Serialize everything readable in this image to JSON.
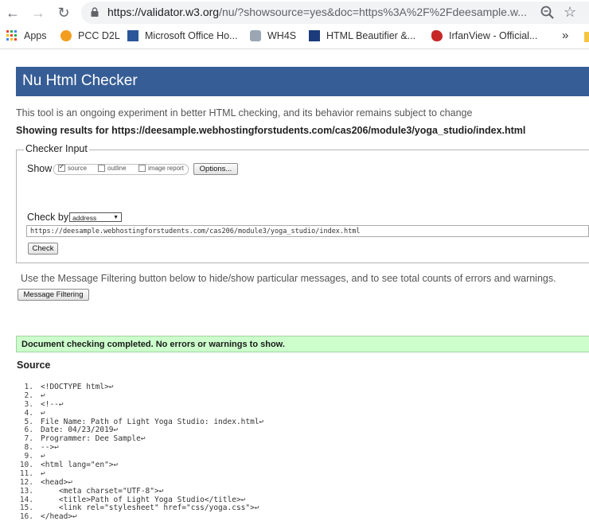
{
  "browser": {
    "url_host": "https://validator.w3.org",
    "url_rest": "/nu/?showsource=yes&doc=https%3A%2F%2Fdeesample.w...",
    "bookmarks": [
      {
        "label": "Apps"
      },
      {
        "label": "PCC D2L"
      },
      {
        "label": "Microsoft Office Ho..."
      },
      {
        "label": "WH4S"
      },
      {
        "label": "HTML Beautifier &..."
      },
      {
        "label": "IrfanView - Official..."
      }
    ],
    "more_glyph": "»"
  },
  "page": {
    "title": "Nu Html Checker",
    "intro": "This tool is an ongoing experiment in better HTML checking, and its behavior remains subject to change",
    "showing": "Showing results for https://deesample.webhostingforstudents.com/cas206/module3/yoga_studio/index.html",
    "checker": {
      "legend": "Checker Input",
      "show_label": "Show",
      "options": [
        {
          "label": "source",
          "checked": true
        },
        {
          "label": "outline",
          "checked": false
        },
        {
          "label": "image report",
          "checked": false
        }
      ],
      "options_button": "Options...",
      "check_by_label": "Check by",
      "check_by_value": "address",
      "address_value": "https://deesample.webhostingforstudents.com/cas206/module3/yoga_studio/index.html",
      "check_button": "Check"
    },
    "filter_info": "Use the Message Filtering button below to hide/show particular messages, and to see total counts of errors and warnings.",
    "filter_button": "Message Filtering",
    "success": "Document checking completed. No errors or warnings to show.",
    "source_heading": "Source",
    "source_lines": [
      {
        "n": "1.",
        "code": "<!DOCTYPE html>↩"
      },
      {
        "n": "2.",
        "code": "↩"
      },
      {
        "n": "3.",
        "code": "<!--↩"
      },
      {
        "n": "4.",
        "code": "↩"
      },
      {
        "n": "5.",
        "code": "File Name: Path of Light Yoga Studio: index.html↩"
      },
      {
        "n": "6.",
        "code": "Date: 04/23/2019↩"
      },
      {
        "n": "7.",
        "code": "Programmer: Dee Sample↩"
      },
      {
        "n": "8.",
        "code": "-->↩"
      },
      {
        "n": "9.",
        "code": "↩"
      },
      {
        "n": "10.",
        "code": "<html lang=\"en\">↩"
      },
      {
        "n": "11.",
        "code": "↩"
      },
      {
        "n": "12.",
        "code": "<head>↩"
      },
      {
        "n": "13.",
        "code": "    <meta charset=\"UTF-8\">↩"
      },
      {
        "n": "14.",
        "code": "    <title>Path of Light Yoga Studio</title>↩"
      },
      {
        "n": "15.",
        "code": "    <link rel=\"stylesheet\" href=\"css/yoga.css\">↩"
      },
      {
        "n": "16.",
        "code": "</head>↩"
      }
    ]
  },
  "colors": {
    "banner": "#365d95",
    "success_bg": "#ccffcc"
  }
}
